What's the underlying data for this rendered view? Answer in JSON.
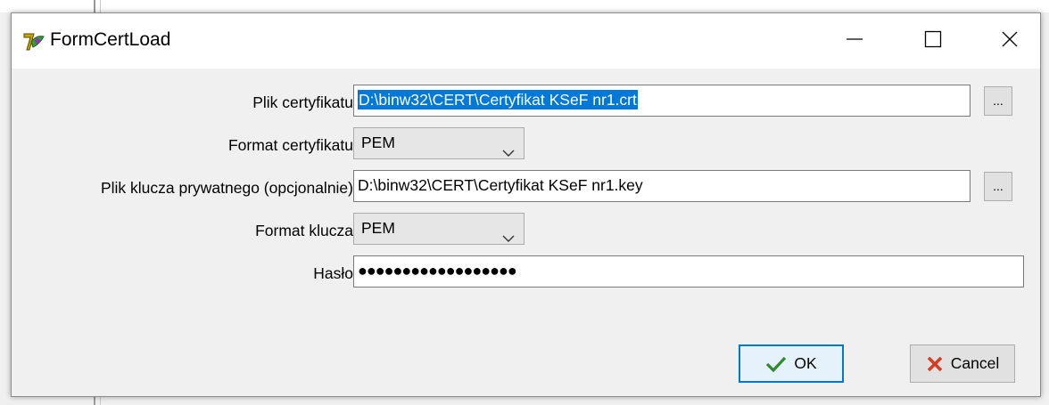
{
  "window": {
    "title": "FormCertLoad"
  },
  "titlebar_icons": {
    "app": "app-icon",
    "minimize": "minimize-icon",
    "maximize": "maximize-icon",
    "close": "close-icon"
  },
  "form": {
    "cert_file_label": "Plik certyfikatu",
    "cert_file_value": "D:\\binw32\\CERT\\Certyfikat KSeF nr1.crt",
    "cert_format_label": "Format certyfikatu",
    "cert_format_value": "PEM",
    "key_file_label": "Plik klucza prywatnego (opcjonalnie)",
    "key_file_value": "D:\\binw32\\CERT\\Certyfikat KSeF nr1.key",
    "key_format_label": "Format klucza",
    "key_format_value": "PEM",
    "password_label": "Hasło",
    "password_value": "●●●●●●●●●●●●●●●●●●",
    "browse_label": "..."
  },
  "buttons": {
    "ok_label": "OK",
    "cancel_label": "Cancel"
  },
  "colors": {
    "selection": "#0078d7",
    "ok_check": "#2e8b2e",
    "cancel_x": "#d83b1f"
  }
}
